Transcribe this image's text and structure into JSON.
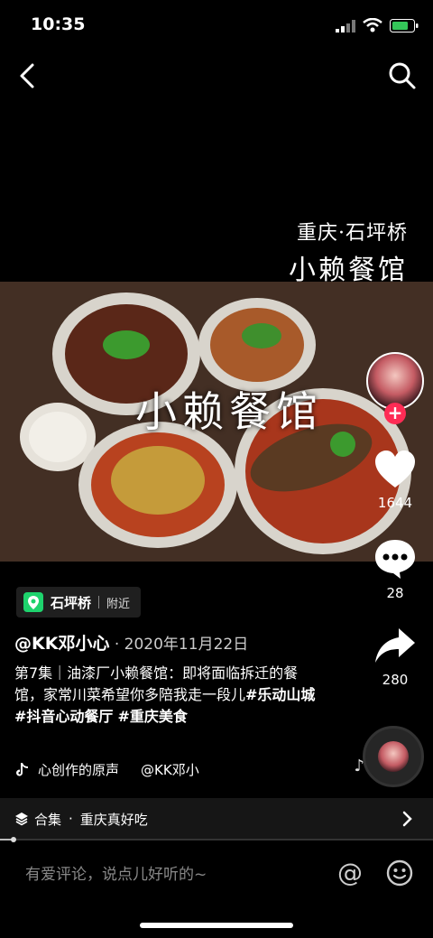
{
  "status_bar": {
    "time": "10:35"
  },
  "video": {
    "caption_line1": "重庆·石坪桥",
    "caption_line2": "小赖餐馆",
    "overlay_title": "小赖餐馆"
  },
  "rail": {
    "likes": "1644",
    "comments": "28",
    "shares": "280",
    "follow_symbol": "+"
  },
  "location": {
    "name": "石坪桥",
    "tag": "附近"
  },
  "post": {
    "author": "@KK邓小心",
    "date_sep": " · ",
    "date": "2020年11月22日",
    "desc_plain": "第7集｜油漆厂小赖餐馆：即将面临拆迁的餐馆，家常川菜希望你多陪我走一段儿",
    "tag1": "#乐动山城",
    "tag2": "#抖音心动餐厅",
    "tag3": "#重庆美食",
    "music_text": "心创作的原声",
    "music_author": "@KK邓小"
  },
  "collection": {
    "label": "合集",
    "sep": "·",
    "name": "重庆真好吃"
  },
  "comment_bar": {
    "placeholder": "有爱评论，说点儿好听的~",
    "at_symbol": "@"
  },
  "icons": [
    "back-icon",
    "search-icon",
    "heart-icon",
    "comment-icon",
    "share-icon",
    "location-pin-icon",
    "tiktok-note-icon",
    "layers-icon",
    "chevron-right-icon",
    "emoji-icon",
    "music-note-icon"
  ],
  "colors": {
    "accent": "#fe2c55",
    "location": "#1ed36d",
    "background": "#000000"
  }
}
